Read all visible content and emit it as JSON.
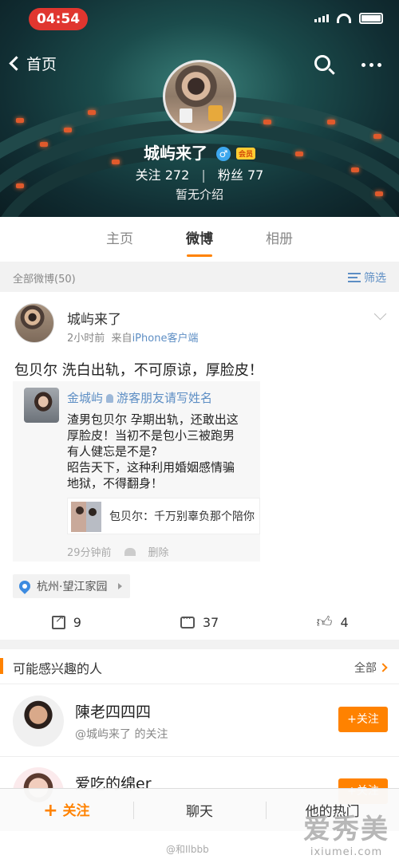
{
  "status_bar": {
    "time": "04:54"
  },
  "nav": {
    "back_label": "首页"
  },
  "profile": {
    "name": "城屿来了",
    "gender_symbol": "♂",
    "vip_label": "会员",
    "following_label": "关注",
    "following_count": "272",
    "followers_label": "粉丝",
    "followers_count": "77",
    "intro": "暂无介绍"
  },
  "tabs": [
    {
      "label": "主页"
    },
    {
      "label": "微博",
      "active": true
    },
    {
      "label": "相册"
    }
  ],
  "filter_bar": {
    "all_posts": "全部微博(50)",
    "filter_label": "筛选"
  },
  "post": {
    "author": "城屿来了",
    "time": "2小时前",
    "source_prefix": "来自",
    "source": "iPhone客户端",
    "text": "包贝尔 洗白出轨，不可原谅，厚脸皮！",
    "repost": {
      "author": "金城屿",
      "topic": "游客朋友请写姓名",
      "lines": [
        "渣男包贝尔 孕期出轨，还敢出这",
        "厚脸皮！当初不是包小三被跑男",
        "有人健忘是不是?",
        "昭告天下，这种利用婚姻感情骗",
        "地狱，不得翻身！"
      ],
      "link_text": "包贝尔：千万别辜负那个陪你",
      "time": "29分钟前",
      "delete_label": "删除"
    },
    "location": "杭州·望江家园",
    "shares": "9",
    "comments": "37",
    "likes": "4"
  },
  "suggestions": {
    "title": "可能感兴趣的人",
    "all_label": "全部",
    "people": [
      {
        "name": "陳老四四四",
        "reason": "@城屿来了 的关注",
        "button": "+关注"
      },
      {
        "name": "爱吃的绵er",
        "reason": "",
        "button": "+关注"
      }
    ]
  },
  "bottom_bar": {
    "follow": "关注",
    "chat": "聊天",
    "hot": "他的热门"
  },
  "watermark": {
    "brand": "爱秀美",
    "url": "ixiumei.com",
    "weibo_tag": "@和Ilbbb"
  },
  "colors": {
    "accent": "#ff8200",
    "link": "#5d8ec4",
    "status_pill": "#e0362f"
  }
}
